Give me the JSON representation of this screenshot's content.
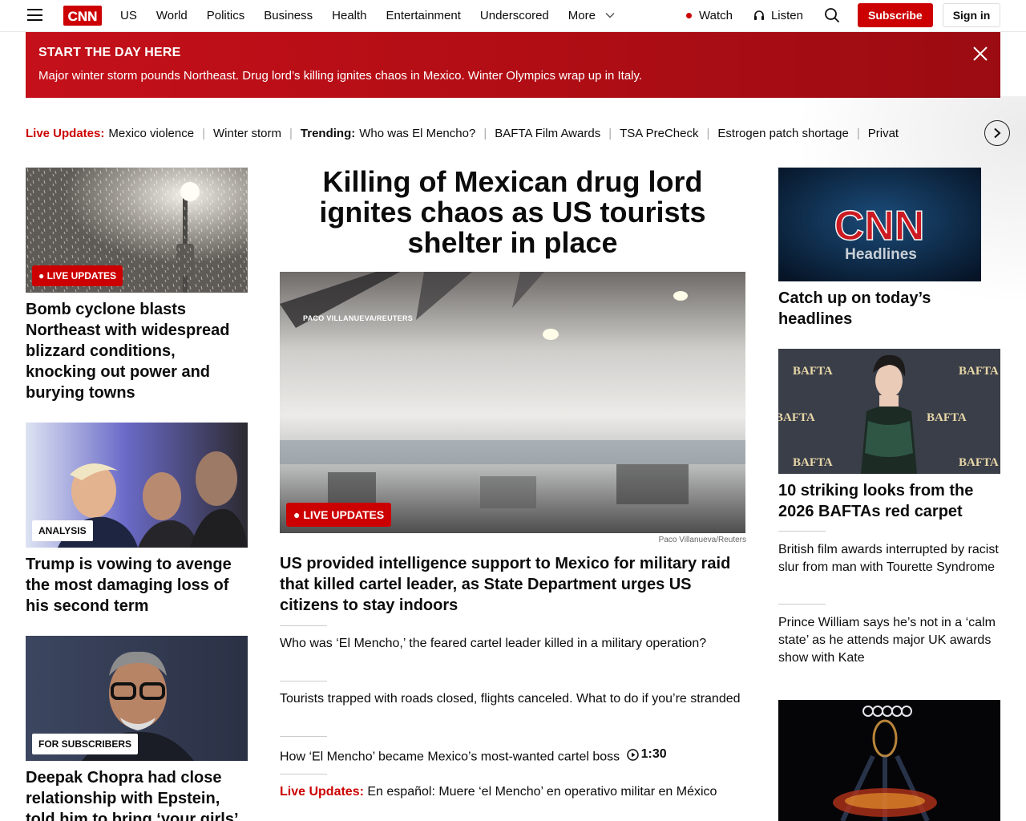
{
  "header": {
    "logo_text": "CNN",
    "nav": [
      "US",
      "World",
      "Politics",
      "Business",
      "Health",
      "Entertainment",
      "Underscored"
    ],
    "more_label": "More",
    "watch_label": "Watch",
    "listen_label": "Listen",
    "subscribe_label": "Subscribe",
    "signin_label": "Sign in"
  },
  "banner": {
    "title": "START THE DAY HERE",
    "text": "Major winter storm pounds Northeast. Drug lord’s killing ignites chaos in Mexico. Winter Olympics wrap up in Italy."
  },
  "trending": {
    "live_label": "Live Updates:",
    "live_items": [
      "Mexico violence",
      "Winter storm"
    ],
    "trending_label": "Trending:",
    "items": [
      "Who was El Mencho?",
      "BAFTA Film Awards",
      "TSA PreCheck",
      "Estrogen patch shortage",
      "Privat"
    ]
  },
  "left": [
    {
      "badge": "LIVE UPDATES",
      "title": "Bomb cyclone blasts Northeast with widespread blizzard conditions, knocking out power and burying towns"
    },
    {
      "badge": "ANALYSIS",
      "title": "Trump is vowing to avenge the most damaging loss of his second term"
    },
    {
      "badge": "FOR SUBSCRIBERS",
      "title": "Deepak Chopra had close relationship with Epstein, told him to bring ‘your girls’"
    }
  ],
  "center": {
    "headline": "Killing of Mexican drug lord ignites chaos as US tourists shelter in place",
    "image_overlay_credit": "PACO VILLANUEVA/REUTERS",
    "badge": "LIVE UPDATES",
    "credit": "Paco Villanueva/Reuters",
    "sub_head": "US provided intelligence support to Mexico for military raid that killed cartel leader, as State Department urges US citizens to stay indoors",
    "items": [
      "Who was ‘El Mencho,’ the feared cartel leader killed in a military operation?",
      "Tourists trapped with roads closed, flights canceled. What to do if you’re stranded",
      "How ‘El Mencho’ became Mexico’s most-wanted cartel boss"
    ],
    "video_duration": "1:30",
    "live_item_label": "Live Updates:",
    "live_item_text": "En español: Muere ‘el Mencho’ en operativo militar en México"
  },
  "right": {
    "headlines_card_logo": "CNN",
    "headlines_card_text": "Headlines",
    "headlines_title": "Catch up on today’s headlines",
    "bafta_backdrop_text": "BAFTA",
    "bafta_title": "10 striking looks from the 2026 BAFTAs red carpet",
    "items": [
      "British film awards interrupted by racist slur from man with Tourette Syndrome",
      "Prince William says he’s not in a ‘calm state’ as he attends major UK awards show with Kate"
    ]
  },
  "colors": {
    "brand_red": "#cc0000",
    "banner_red": "#b20d15"
  }
}
